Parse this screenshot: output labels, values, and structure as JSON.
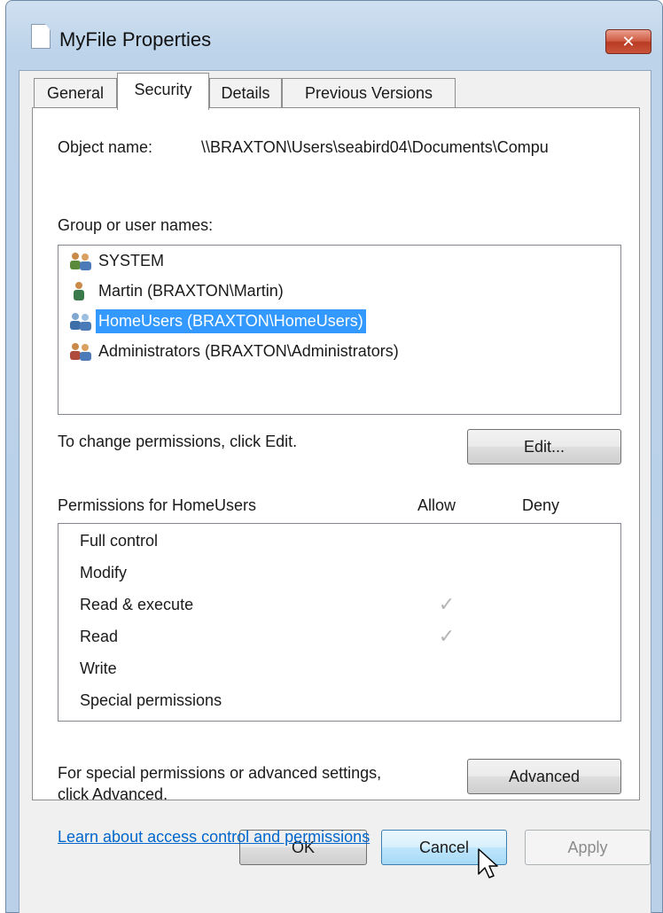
{
  "window": {
    "title": "MyFile Properties",
    "close_label": "✕"
  },
  "tabs": [
    {
      "label": "General",
      "active": false
    },
    {
      "label": "Security",
      "active": true
    },
    {
      "label": "Details",
      "active": false
    },
    {
      "label": "Previous Versions",
      "active": false
    }
  ],
  "security": {
    "object_name_label": "Object name:",
    "object_name_value": "\\\\BRAXTON\\Users\\seabird04\\Documents\\Compu",
    "group_label": "Group or user names:",
    "users": [
      {
        "name": "SYSTEM",
        "icon": "group-users-icon",
        "selected": false
      },
      {
        "name": "Martin (BRAXTON\\Martin)",
        "icon": "user-icon",
        "selected": false
      },
      {
        "name": "HomeUsers (BRAXTON\\HomeUsers)",
        "icon": "group-users-icon",
        "selected": true
      },
      {
        "name": "Administrators (BRAXTON\\Administrators)",
        "icon": "group-users-icon",
        "selected": false
      }
    ],
    "change_hint": "To change permissions, click Edit.",
    "edit_button": "Edit...",
    "permissions_header": "Permissions for HomeUsers",
    "allow_header": "Allow",
    "deny_header": "Deny",
    "permissions": [
      {
        "name": "Full control",
        "allow": false,
        "deny": false
      },
      {
        "name": "Modify",
        "allow": false,
        "deny": false
      },
      {
        "name": "Read & execute",
        "allow": true,
        "deny": false
      },
      {
        "name": "Read",
        "allow": true,
        "deny": false
      },
      {
        "name": "Write",
        "allow": false,
        "deny": false
      },
      {
        "name": "Special permissions",
        "allow": false,
        "deny": false
      }
    ],
    "check_glyph": "✓",
    "advanced_hint_line1": "For special permissions or advanced settings,",
    "advanced_hint_line2": "click Advanced.",
    "advanced_button": "Advanced",
    "help_link": "Learn about access control and permissions"
  },
  "footer": {
    "ok": "OK",
    "cancel": "Cancel",
    "apply": "Apply"
  },
  "colors": {
    "selection": "#3399ff",
    "link": "#0066cc",
    "close_button": "#c9553c"
  }
}
